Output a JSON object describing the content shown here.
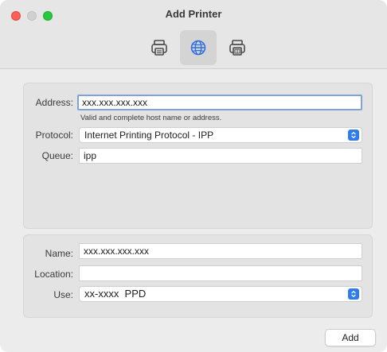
{
  "window": {
    "title": "Add Printer"
  },
  "toolbar": {
    "items": [
      {
        "name": "Default",
        "icon": "printer-icon",
        "selected": false
      },
      {
        "name": "IP",
        "icon": "globe-icon",
        "selected": true
      },
      {
        "name": "Windows",
        "icon": "printer-queue-icon",
        "selected": false
      }
    ]
  },
  "connection": {
    "address_label": "Address:",
    "address_value": "xxx.xxx.xxx.xxx",
    "address_hint": "Valid and complete host name or address.",
    "protocol_label": "Protocol:",
    "protocol_value": "Internet Printing Protocol - IPP",
    "queue_label": "Queue:",
    "queue_value": "ipp"
  },
  "details": {
    "name_label": "Name:",
    "name_value": "xxx.xxx.xxx.xxx",
    "location_label": "Location:",
    "location_value": "",
    "use_label": "Use:",
    "use_value": "xx-xxxx  PPD"
  },
  "footer": {
    "add_label": "Add"
  },
  "colors": {
    "accent": "#2f7bf6",
    "focus_ring": "#7fa3d8",
    "close": "#ff5f57",
    "zoom": "#28c840"
  }
}
